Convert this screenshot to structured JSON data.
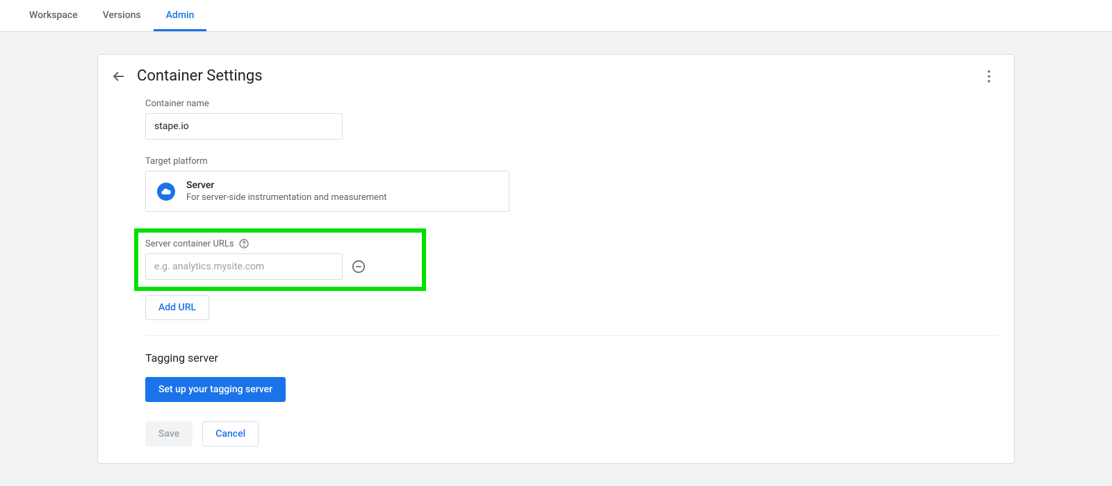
{
  "tabs": {
    "workspace": "Workspace",
    "versions": "Versions",
    "admin": "Admin"
  },
  "header": {
    "title": "Container Settings"
  },
  "container_name": {
    "label": "Container name",
    "value": "stape.io"
  },
  "target_platform": {
    "label": "Target platform",
    "title": "Server",
    "description": "For server-side instrumentation and measurement"
  },
  "server_urls": {
    "label": "Server container URLs",
    "placeholder": "e.g. analytics.mysite.com",
    "add_label": "Add URL"
  },
  "tagging": {
    "heading": "Tagging server",
    "setup_button": "Set up your tagging server"
  },
  "actions": {
    "save": "Save",
    "cancel": "Cancel"
  }
}
